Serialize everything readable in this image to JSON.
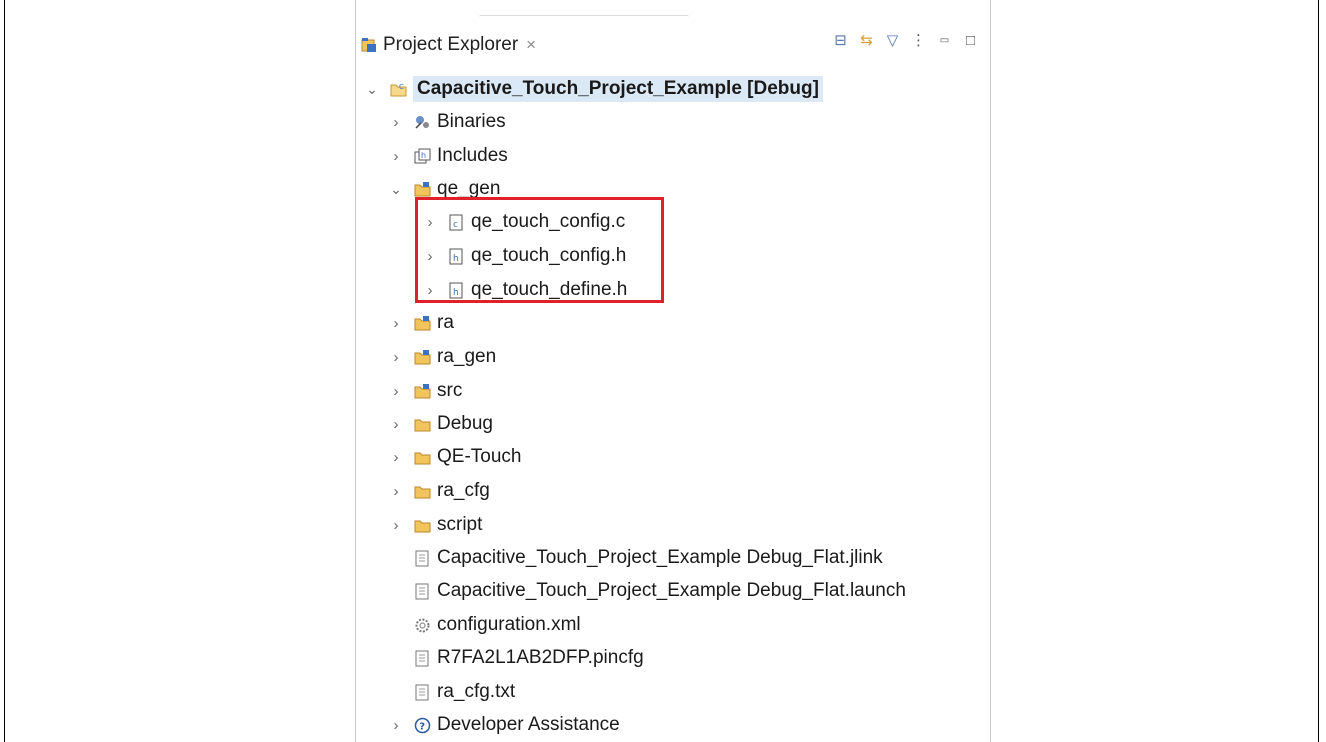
{
  "view": {
    "tab_title": "Project Explorer",
    "close_glyph": "×"
  },
  "toolbar": {
    "collapse_all": "⊟",
    "link_with_editor": "⇆",
    "filter": "▽",
    "view_menu": "⋮",
    "minimize": "▭",
    "maximize": "□"
  },
  "tree": {
    "project": "Capacitive_Touch_Project_Example [Debug]",
    "items": [
      {
        "label": "Binaries",
        "icon": "binaries-icon",
        "expanded": false
      },
      {
        "label": "Includes",
        "icon": "includes-icon",
        "expanded": false
      },
      {
        "label": "qe_gen",
        "icon": "source-folder-icon",
        "expanded": true
      },
      {
        "label": "qe_touch_config.c",
        "icon": "c-file-icon",
        "expanded": false
      },
      {
        "label": "qe_touch_config.h",
        "icon": "h-file-icon",
        "expanded": false
      },
      {
        "label": "qe_touch_define.h",
        "icon": "h-file-icon",
        "expanded": false
      },
      {
        "label": "ra",
        "icon": "source-folder-icon",
        "expanded": false
      },
      {
        "label": "ra_gen",
        "icon": "source-folder-icon",
        "expanded": false
      },
      {
        "label": "src",
        "icon": "source-folder-icon",
        "expanded": false
      },
      {
        "label": "Debug",
        "icon": "folder-icon",
        "expanded": false
      },
      {
        "label": "QE-Touch",
        "icon": "folder-icon",
        "expanded": false
      },
      {
        "label": "ra_cfg",
        "icon": "folder-icon",
        "expanded": false
      },
      {
        "label": "script",
        "icon": "folder-icon",
        "expanded": false
      },
      {
        "label": "Capacitive_Touch_Project_Example Debug_Flat.jlink",
        "icon": "text-file-icon"
      },
      {
        "label": "Capacitive_Touch_Project_Example Debug_Flat.launch",
        "icon": "text-file-icon"
      },
      {
        "label": "configuration.xml",
        "icon": "gear-file-icon"
      },
      {
        "label": "R7FA2L1AB2DFP.pincfg",
        "icon": "text-file-icon"
      },
      {
        "label": "ra_cfg.txt",
        "icon": "text-file-icon"
      },
      {
        "label": "Developer Assistance",
        "icon": "help-icon",
        "expanded": false
      }
    ]
  },
  "colors": {
    "highlight_box": "#e0202a",
    "selection": "#dbe8f5",
    "folder": "#e8b84a"
  }
}
